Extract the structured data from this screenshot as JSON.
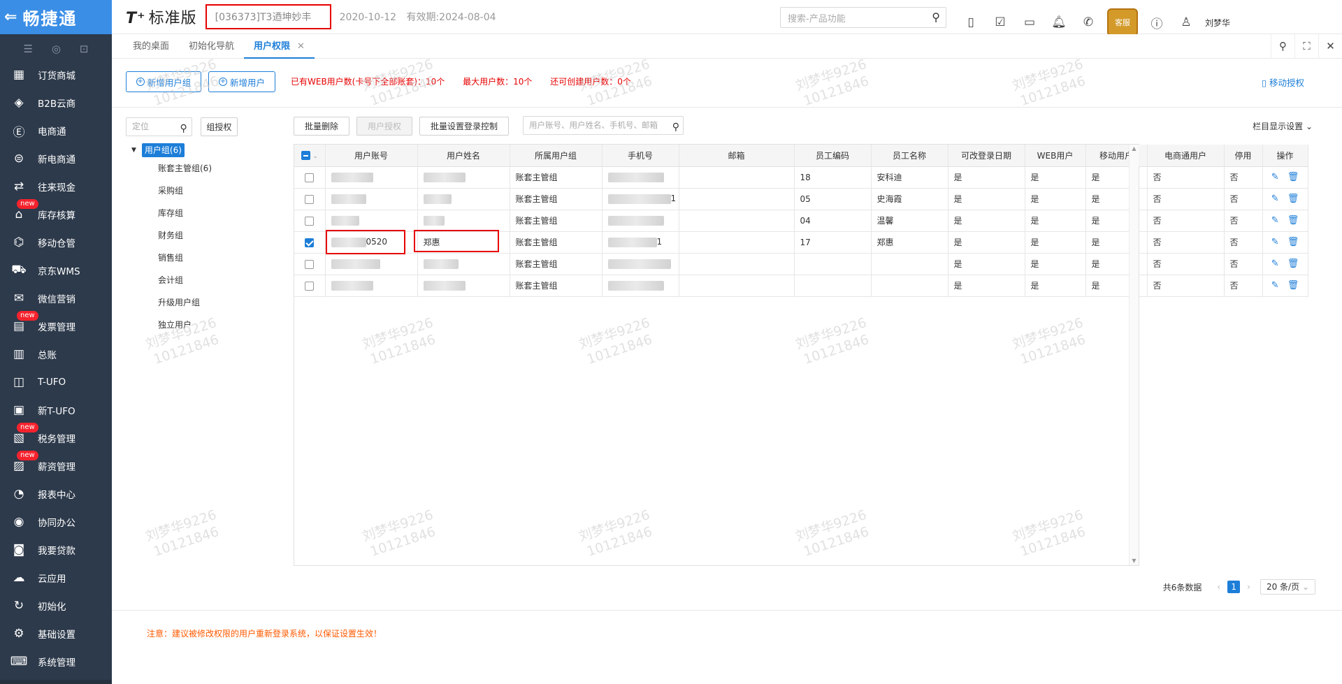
{
  "brand": {
    "back_icon": "arrow-left-icon",
    "name": "畅捷通"
  },
  "side_tools": [
    "menu-icon",
    "search-icon",
    "edit-icon"
  ],
  "sidebar": {
    "items": [
      {
        "label": "订货商城",
        "icon": "store-icon",
        "badge": ""
      },
      {
        "label": "B2B云商",
        "icon": "bag-icon",
        "badge": ""
      },
      {
        "label": "电商通",
        "icon": "circle-e-icon",
        "badge": ""
      },
      {
        "label": "新电商通",
        "icon": "circle-new-icon",
        "badge": ""
      },
      {
        "label": "往来现金",
        "icon": "exchange-icon",
        "badge": ""
      },
      {
        "label": "库存核算",
        "icon": "warehouse-icon",
        "badge": "new"
      },
      {
        "label": "移动仓管",
        "icon": "mobile-warehouse-icon",
        "badge": ""
      },
      {
        "label": "京东WMS",
        "icon": "truck-icon",
        "badge": ""
      },
      {
        "label": "微信营销",
        "icon": "wechat-icon",
        "badge": ""
      },
      {
        "label": "发票管理",
        "icon": "invoice-icon",
        "badge": "new"
      },
      {
        "label": "总账",
        "icon": "ledger-icon",
        "badge": ""
      },
      {
        "label": "T-UFO",
        "icon": "ufo-icon",
        "badge": ""
      },
      {
        "label": "新T-UFO",
        "icon": "new-ufo-icon",
        "badge": ""
      },
      {
        "label": "税务管理",
        "icon": "tax-icon",
        "badge": "new"
      },
      {
        "label": "薪资管理",
        "icon": "salary-icon",
        "badge": "new"
      },
      {
        "label": "报表中心",
        "icon": "pie-chart-icon",
        "badge": ""
      },
      {
        "label": "协同办公",
        "icon": "collab-icon",
        "badge": ""
      },
      {
        "label": "我要贷款",
        "icon": "loan-icon",
        "badge": ""
      },
      {
        "label": "云应用",
        "icon": "cloud-icon",
        "badge": ""
      },
      {
        "label": "初始化",
        "icon": "refresh-icon",
        "badge": ""
      },
      {
        "label": "基础设置",
        "icon": "settings-icon",
        "badge": ""
      },
      {
        "label": "系统管理",
        "icon": "system-icon",
        "badge": ""
      }
    ]
  },
  "header": {
    "logo": "T⁺",
    "edition": "标准版",
    "account": "[036373]T3迺坤妙丰",
    "date": "2020-10-12",
    "validity": "有效期:2024-08-04",
    "search_placeholder": "搜索-产品功能",
    "icons": [
      "doc-icon",
      "task-icon",
      "message-icon",
      "bell-icon",
      "phone-icon"
    ],
    "avatar_text": "客服",
    "help_icon": "help-icon",
    "user_icon": "user-icon",
    "username": "刘梦华"
  },
  "tabs": [
    {
      "label": "我的桌面",
      "active": false
    },
    {
      "label": "初始化导航",
      "active": false
    },
    {
      "label": "用户权限",
      "active": true
    }
  ],
  "tab_close": "✕",
  "actions": {
    "add_group": "新增用户组",
    "add_user": "新增用户",
    "stat1": "已有WEB用户数(卡号下全部账套)：10个",
    "stat2": "最大用户数：10个",
    "stat3": "还可创建用户数：0个",
    "mobile_auth": "移动授权"
  },
  "tree": {
    "search_placeholder": "定位",
    "group_auth": "组授权",
    "root": "用户组(6)",
    "nodes": [
      "账套主管组(6)",
      "采购组",
      "库存组",
      "财务组",
      "销售组",
      "会计组",
      "升级用户组",
      "独立用户"
    ]
  },
  "toolbar": {
    "batch_delete": "批量删除",
    "user_auth": "用户授权",
    "batch_login": "批量设置登录控制",
    "search_placeholder": "用户账号、用户姓名、手机号、邮箱",
    "col_setting": "栏目显示设置"
  },
  "table": {
    "headers": [
      "用户账号",
      "用户姓名",
      "所属用户组",
      "手机号",
      "邮箱",
      "员工编码",
      "员工名称",
      "可改登录日期",
      "WEB用户",
      "移动用户",
      "电商通用户",
      "停用",
      "操作"
    ],
    "rows": [
      {
        "account": "",
        "name": "",
        "group": "账套主管组",
        "phone": "",
        "email": "",
        "emp_code": "18",
        "emp_name": "安科迪",
        "can_change": "是",
        "web": "是",
        "mobile": "是",
        "ecom": "否",
        "disabled": "否",
        "checked": false
      },
      {
        "account": "",
        "name": "",
        "group": "账套主管组",
        "phone": "1",
        "email": "",
        "emp_code": "05",
        "emp_name": "史海霞",
        "can_change": "是",
        "web": "是",
        "mobile": "是",
        "ecom": "否",
        "disabled": "否",
        "checked": false
      },
      {
        "account": "",
        "name": "",
        "group": "账套主管组",
        "phone": "",
        "email": "",
        "emp_code": "04",
        "emp_name": "温馨",
        "can_change": "是",
        "web": "是",
        "mobile": "是",
        "ecom": "否",
        "disabled": "否",
        "checked": false
      },
      {
        "account": "0520",
        "name": "郑惠",
        "group": "账套主管组",
        "phone": "1",
        "email": "",
        "emp_code": "17",
        "emp_name": "郑惠",
        "can_change": "是",
        "web": "是",
        "mobile": "是",
        "ecom": "否",
        "disabled": "否",
        "checked": true
      },
      {
        "account": "",
        "name": "",
        "group": "账套主管组",
        "phone": "",
        "email": "",
        "emp_code": "",
        "emp_name": "",
        "can_change": "是",
        "web": "是",
        "mobile": "是",
        "ecom": "否",
        "disabled": "否",
        "checked": false
      },
      {
        "account": "",
        "name": "",
        "group": "账套主管组",
        "phone": "",
        "email": "",
        "emp_code": "",
        "emp_name": "",
        "can_change": "是",
        "web": "是",
        "mobile": "是",
        "ecom": "否",
        "disabled": "否",
        "checked": false
      }
    ]
  },
  "pager": {
    "total": "共6条数据",
    "prev": "‹",
    "page": "1",
    "next": "›",
    "size": "20 条/页"
  },
  "notice": "注意：建议被修改权限的用户重新登录系统，以保证设置生效！",
  "watermark": {
    "name": "刘梦华9226",
    "code": "10121846"
  },
  "colors": {
    "primary": "#1d7ed8",
    "sidebar": "#2d3a4b",
    "brand_bar": "#3a8ee6",
    "alert": "#e60000",
    "notice": "#ff5a00"
  }
}
